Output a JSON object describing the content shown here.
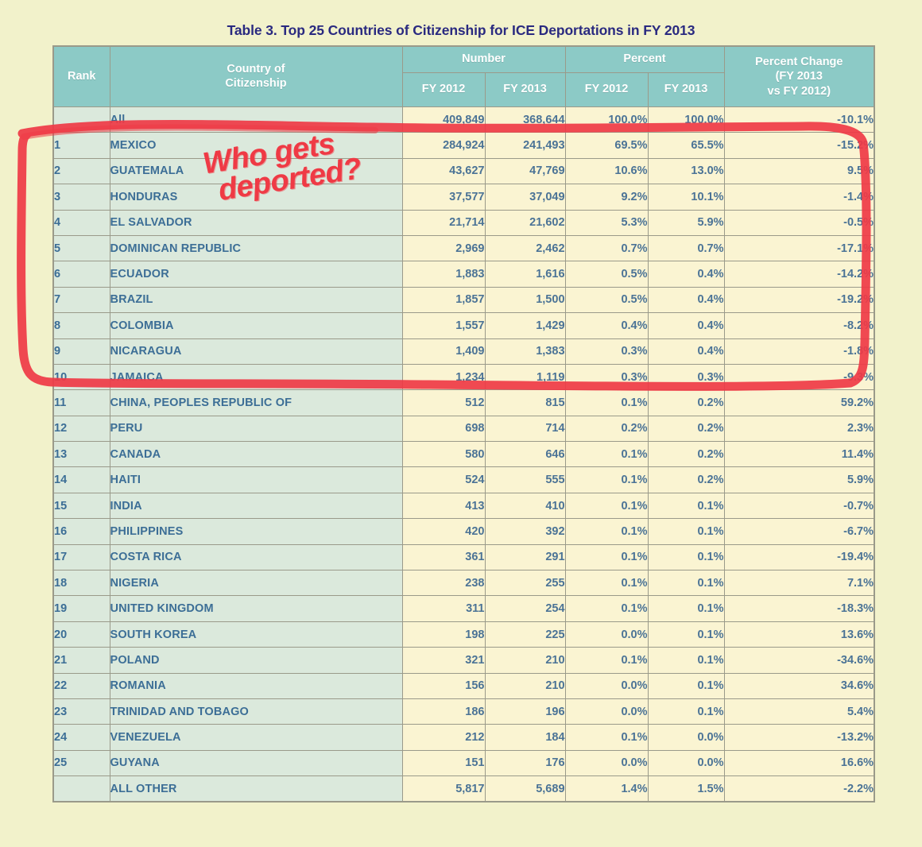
{
  "title": "Table 3. Top 25 Countries of Citizenship for ICE Deportations in FY 2013",
  "colors": {
    "page_background": "#f2f2cb",
    "header_teal": "#8ccac6",
    "label_cell_green": "#dbe9dc",
    "number_cell_cream": "#faf4d2",
    "title_navy": "#2a2a80",
    "body_text_blue": "#4b7396",
    "annotation_red": "#ef3a45",
    "border_gray": "#9a9a8a"
  },
  "header": {
    "rank": "Rank",
    "country": "Country of\nCitizenship",
    "country_line1": "Country of",
    "country_line2": "Citizenship",
    "group_number": "Number",
    "group_percent": "Percent",
    "pct_change_line1": "Percent Change",
    "pct_change_line2": "(FY 2013",
    "pct_change_line3": "vs FY 2012)",
    "sub_number_fy2012": "FY 2012",
    "sub_number_fy2013": "FY 2013",
    "sub_percent_fy2012": "FY 2012",
    "sub_percent_fy2013": "FY 2013"
  },
  "annotations": {
    "handwriting_line1": "Who gets",
    "handwriting_line2": "deported?",
    "circle_label": "hand-drawn red rectangle enclosing ranks 1 through 10"
  },
  "chart_data": {
    "type": "table",
    "title": "Table 3. Top 25 Countries of Citizenship for ICE Deportations in FY 2013",
    "columns": [
      "Rank",
      "Country of Citizenship",
      "Number FY 2012",
      "Number FY 2013",
      "Percent FY 2012",
      "Percent FY 2013",
      "Percent Change (FY 2013 vs FY 2012)"
    ],
    "rows": [
      {
        "rank": "",
        "country": "All",
        "num2012": "409,849",
        "num2013": "368,644",
        "pct2012": "100.0%",
        "pct2013": "100.0%",
        "change": "-10.1%"
      },
      {
        "rank": "1",
        "country": "MEXICO",
        "num2012": "284,924",
        "num2013": "241,493",
        "pct2012": "69.5%",
        "pct2013": "65.5%",
        "change": "-15.2%"
      },
      {
        "rank": "2",
        "country": "GUATEMALA",
        "num2012": "43,627",
        "num2013": "47,769",
        "pct2012": "10.6%",
        "pct2013": "13.0%",
        "change": "9.5%"
      },
      {
        "rank": "3",
        "country": "HONDURAS",
        "num2012": "37,577",
        "num2013": "37,049",
        "pct2012": "9.2%",
        "pct2013": "10.1%",
        "change": "-1.4%"
      },
      {
        "rank": "4",
        "country": "EL SALVADOR",
        "num2012": "21,714",
        "num2013": "21,602",
        "pct2012": "5.3%",
        "pct2013": "5.9%",
        "change": "-0.5%"
      },
      {
        "rank": "5",
        "country": "DOMINICAN REPUBLIC",
        "num2012": "2,969",
        "num2013": "2,462",
        "pct2012": "0.7%",
        "pct2013": "0.7%",
        "change": "-17.1%"
      },
      {
        "rank": "6",
        "country": "ECUADOR",
        "num2012": "1,883",
        "num2013": "1,616",
        "pct2012": "0.5%",
        "pct2013": "0.4%",
        "change": "-14.2%"
      },
      {
        "rank": "7",
        "country": "BRAZIL",
        "num2012": "1,857",
        "num2013": "1,500",
        "pct2012": "0.5%",
        "pct2013": "0.4%",
        "change": "-19.2%"
      },
      {
        "rank": "8",
        "country": "COLOMBIA",
        "num2012": "1,557",
        "num2013": "1,429",
        "pct2012": "0.4%",
        "pct2013": "0.4%",
        "change": "-8.2%"
      },
      {
        "rank": "9",
        "country": "NICARAGUA",
        "num2012": "1,409",
        "num2013": "1,383",
        "pct2012": "0.3%",
        "pct2013": "0.4%",
        "change": "-1.8%"
      },
      {
        "rank": "10",
        "country": "JAMAICA",
        "num2012": "1,234",
        "num2013": "1,119",
        "pct2012": "0.3%",
        "pct2013": "0.3%",
        "change": "-9.3%"
      },
      {
        "rank": "11",
        "country": "CHINA, PEOPLES REPUBLIC OF",
        "num2012": "512",
        "num2013": "815",
        "pct2012": "0.1%",
        "pct2013": "0.2%",
        "change": "59.2%"
      },
      {
        "rank": "12",
        "country": "PERU",
        "num2012": "698",
        "num2013": "714",
        "pct2012": "0.2%",
        "pct2013": "0.2%",
        "change": "2.3%"
      },
      {
        "rank": "13",
        "country": "CANADA",
        "num2012": "580",
        "num2013": "646",
        "pct2012": "0.1%",
        "pct2013": "0.2%",
        "change": "11.4%"
      },
      {
        "rank": "14",
        "country": "HAITI",
        "num2012": "524",
        "num2013": "555",
        "pct2012": "0.1%",
        "pct2013": "0.2%",
        "change": "5.9%"
      },
      {
        "rank": "15",
        "country": "INDIA",
        "num2012": "413",
        "num2013": "410",
        "pct2012": "0.1%",
        "pct2013": "0.1%",
        "change": "-0.7%"
      },
      {
        "rank": "16",
        "country": "PHILIPPINES",
        "num2012": "420",
        "num2013": "392",
        "pct2012": "0.1%",
        "pct2013": "0.1%",
        "change": "-6.7%"
      },
      {
        "rank": "17",
        "country": "COSTA RICA",
        "num2012": "361",
        "num2013": "291",
        "pct2012": "0.1%",
        "pct2013": "0.1%",
        "change": "-19.4%"
      },
      {
        "rank": "18",
        "country": "NIGERIA",
        "num2012": "238",
        "num2013": "255",
        "pct2012": "0.1%",
        "pct2013": "0.1%",
        "change": "7.1%"
      },
      {
        "rank": "19",
        "country": "UNITED KINGDOM",
        "num2012": "311",
        "num2013": "254",
        "pct2012": "0.1%",
        "pct2013": "0.1%",
        "change": "-18.3%"
      },
      {
        "rank": "20",
        "country": "SOUTH KOREA",
        "num2012": "198",
        "num2013": "225",
        "pct2012": "0.0%",
        "pct2013": "0.1%",
        "change": "13.6%"
      },
      {
        "rank": "21",
        "country": "POLAND",
        "num2012": "321",
        "num2013": "210",
        "pct2012": "0.1%",
        "pct2013": "0.1%",
        "change": "-34.6%"
      },
      {
        "rank": "22",
        "country": "ROMANIA",
        "num2012": "156",
        "num2013": "210",
        "pct2012": "0.0%",
        "pct2013": "0.1%",
        "change": "34.6%"
      },
      {
        "rank": "23",
        "country": "TRINIDAD AND TOBAGO",
        "num2012": "186",
        "num2013": "196",
        "pct2012": "0.0%",
        "pct2013": "0.1%",
        "change": "5.4%"
      },
      {
        "rank": "24",
        "country": "VENEZUELA",
        "num2012": "212",
        "num2013": "184",
        "pct2012": "0.1%",
        "pct2013": "0.0%",
        "change": "-13.2%"
      },
      {
        "rank": "25",
        "country": "GUYANA",
        "num2012": "151",
        "num2013": "176",
        "pct2012": "0.0%",
        "pct2013": "0.0%",
        "change": "16.6%"
      },
      {
        "rank": "",
        "country": "ALL OTHER",
        "num2012": "5,817",
        "num2013": "5,689",
        "pct2012": "1.4%",
        "pct2013": "1.5%",
        "change": "-2.2%"
      }
    ]
  }
}
